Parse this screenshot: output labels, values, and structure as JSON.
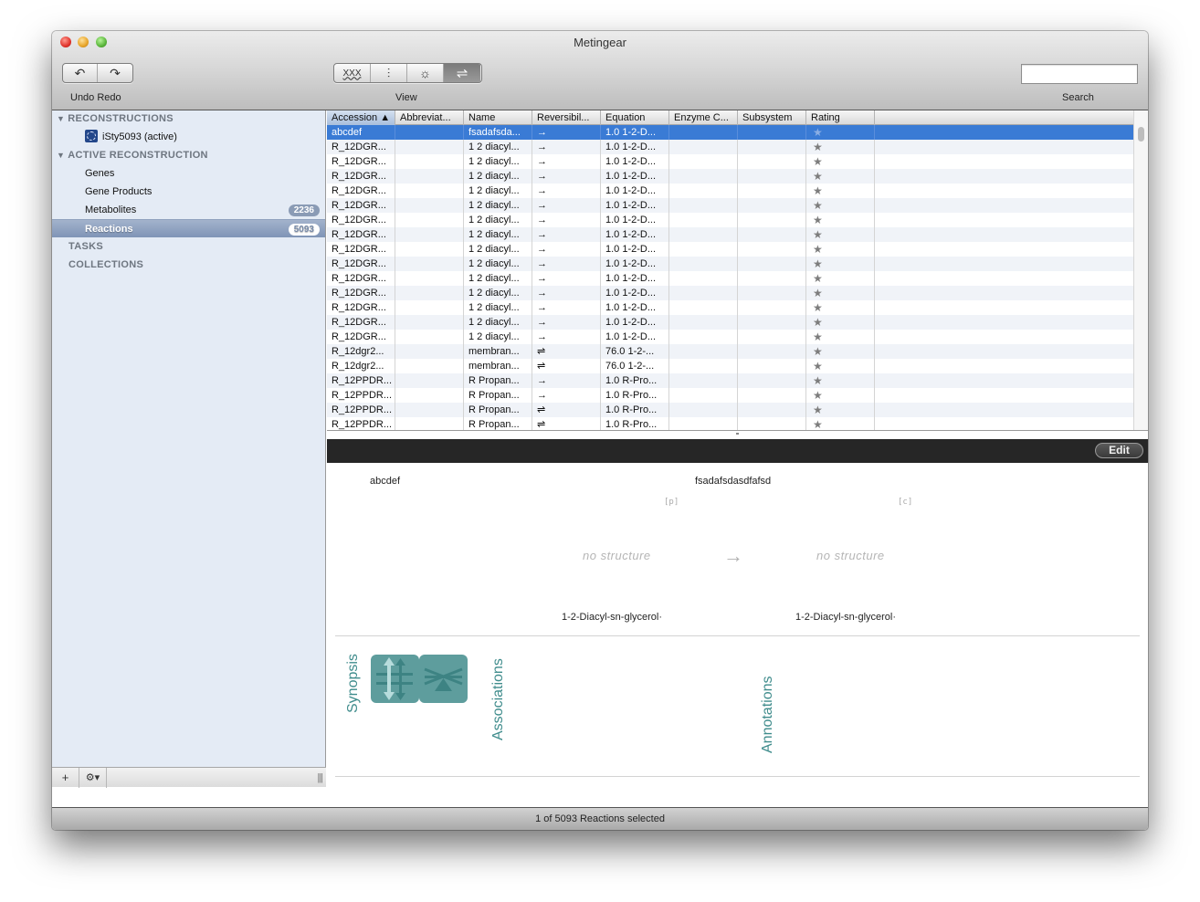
{
  "window": {
    "title": "Metingear"
  },
  "toolbar": {
    "undo_redo_label": "Undo Redo",
    "view_label": "View",
    "search_label": "Search",
    "search_value": "",
    "undo_icon": "↶",
    "redo_icon": "↷",
    "view_buttons": [
      {
        "name": "genes-view",
        "glyph": "ΧΧΧ",
        "active": false
      },
      {
        "name": "gene-products-view",
        "glyph": "⫶",
        "active": false
      },
      {
        "name": "metabolites-view",
        "glyph": "☼",
        "active": false
      },
      {
        "name": "reactions-view",
        "glyph": "⇌",
        "active": true
      }
    ]
  },
  "sidebar": {
    "groups": {
      "reconstructions": "RECONSTRUCTIONS",
      "active_reconstruction": "ACTIVE RECONSTRUCTION",
      "tasks": "TASKS",
      "collections": "COLLECTIONS"
    },
    "reconstruction_item": "iSty5093 (active)",
    "items": [
      {
        "label": "Genes",
        "badge": null
      },
      {
        "label": "Gene Products",
        "badge": null
      },
      {
        "label": "Metabolites",
        "badge": "2236"
      },
      {
        "label": "Reactions",
        "badge": "5093",
        "selected": true
      }
    ],
    "footer": {
      "add": "+",
      "gear": "⚙▾",
      "grip": "|||"
    }
  },
  "table": {
    "columns": [
      "Accession ▲",
      "Abbreviat...",
      "Name",
      "Reversibil...",
      "Equation",
      "Enzyme C...",
      "Subsystem",
      "Rating"
    ],
    "rows": [
      {
        "accession": "abcdef",
        "abbreviation": "",
        "name": "fsadafsda...",
        "reversibility": "→",
        "equation": "1.0 1-2-D...",
        "enzyme": "",
        "subsystem": "",
        "rating": "★",
        "selected": true
      },
      {
        "accession": "R_12DGR...",
        "abbreviation": "",
        "name": "1 2 diacyl...",
        "reversibility": "→",
        "equation": "1.0 1-2-D...",
        "enzyme": "",
        "subsystem": "",
        "rating": "★"
      },
      {
        "accession": "R_12DGR...",
        "abbreviation": "",
        "name": "1 2 diacyl...",
        "reversibility": "→",
        "equation": "1.0 1-2-D...",
        "enzyme": "",
        "subsystem": "",
        "rating": "★"
      },
      {
        "accession": "R_12DGR...",
        "abbreviation": "",
        "name": "1 2 diacyl...",
        "reversibility": "→",
        "equation": "1.0 1-2-D...",
        "enzyme": "",
        "subsystem": "",
        "rating": "★"
      },
      {
        "accession": "R_12DGR...",
        "abbreviation": "",
        "name": "1 2 diacyl...",
        "reversibility": "→",
        "equation": "1.0 1-2-D...",
        "enzyme": "",
        "subsystem": "",
        "rating": "★"
      },
      {
        "accession": "R_12DGR...",
        "abbreviation": "",
        "name": "1 2 diacyl...",
        "reversibility": "→",
        "equation": "1.0 1-2-D...",
        "enzyme": "",
        "subsystem": "",
        "rating": "★"
      },
      {
        "accession": "R_12DGR...",
        "abbreviation": "",
        "name": "1 2 diacyl...",
        "reversibility": "→",
        "equation": "1.0 1-2-D...",
        "enzyme": "",
        "subsystem": "",
        "rating": "★"
      },
      {
        "accession": "R_12DGR...",
        "abbreviation": "",
        "name": "1 2 diacyl...",
        "reversibility": "→",
        "equation": "1.0 1-2-D...",
        "enzyme": "",
        "subsystem": "",
        "rating": "★"
      },
      {
        "accession": "R_12DGR...",
        "abbreviation": "",
        "name": "1 2 diacyl...",
        "reversibility": "→",
        "equation": "1.0 1-2-D...",
        "enzyme": "",
        "subsystem": "",
        "rating": "★"
      },
      {
        "accession": "R_12DGR...",
        "abbreviation": "",
        "name": "1 2 diacyl...",
        "reversibility": "→",
        "equation": "1.0 1-2-D...",
        "enzyme": "",
        "subsystem": "",
        "rating": "★"
      },
      {
        "accession": "R_12DGR...",
        "abbreviation": "",
        "name": "1 2 diacyl...",
        "reversibility": "→",
        "equation": "1.0 1-2-D...",
        "enzyme": "",
        "subsystem": "",
        "rating": "★"
      },
      {
        "accession": "R_12DGR...",
        "abbreviation": "",
        "name": "1 2 diacyl...",
        "reversibility": "→",
        "equation": "1.0 1-2-D...",
        "enzyme": "",
        "subsystem": "",
        "rating": "★"
      },
      {
        "accession": "R_12DGR...",
        "abbreviation": "",
        "name": "1 2 diacyl...",
        "reversibility": "→",
        "equation": "1.0 1-2-D...",
        "enzyme": "",
        "subsystem": "",
        "rating": "★"
      },
      {
        "accession": "R_12DGR...",
        "abbreviation": "",
        "name": "1 2 diacyl...",
        "reversibility": "→",
        "equation": "1.0 1-2-D...",
        "enzyme": "",
        "subsystem": "",
        "rating": "★"
      },
      {
        "accession": "R_12DGR...",
        "abbreviation": "",
        "name": "1 2 diacyl...",
        "reversibility": "→",
        "equation": "1.0 1-2-D...",
        "enzyme": "",
        "subsystem": "",
        "rating": "★"
      },
      {
        "accession": "R_12dgr2...",
        "abbreviation": "",
        "name": "membran...",
        "reversibility": "⇌",
        "equation": "76.0 1-2-...",
        "enzyme": "",
        "subsystem": "",
        "rating": "★"
      },
      {
        "accession": "R_12dgr2...",
        "abbreviation": "",
        "name": "membran...",
        "reversibility": "⇌",
        "equation": "76.0 1-2-...",
        "enzyme": "",
        "subsystem": "",
        "rating": "★"
      },
      {
        "accession": "R_12PPDR...",
        "abbreviation": "",
        "name": "R Propan...",
        "reversibility": "→",
        "equation": "1.0 R-Pro...",
        "enzyme": "",
        "subsystem": "",
        "rating": "★"
      },
      {
        "accession": "R_12PPDR...",
        "abbreviation": "",
        "name": "R Propan...",
        "reversibility": "→",
        "equation": "1.0 R-Pro...",
        "enzyme": "",
        "subsystem": "",
        "rating": "★"
      },
      {
        "accession": "R_12PPDR...",
        "abbreviation": "",
        "name": "R Propan...",
        "reversibility": "⇌",
        "equation": "1.0 R-Pro...",
        "enzyme": "",
        "subsystem": "",
        "rating": "★"
      },
      {
        "accession": "R_12PPDR...",
        "abbreviation": "",
        "name": "R Propan...",
        "reversibility": "⇌",
        "equation": "1.0 R-Pro...",
        "enzyme": "",
        "subsystem": "",
        "rating": "★"
      }
    ]
  },
  "detail": {
    "edit_label": "Edit",
    "accession": "abcdef",
    "name": "fsadafsdasdfafsd",
    "reactant": {
      "compartment": "[p]",
      "structure": "no structure",
      "label": "1-2-Diacyl-sn-glycerol·"
    },
    "arrow": "→",
    "product": {
      "compartment": "[c]",
      "structure": "no structure",
      "label": "1-2-Diacyl-sn-glycerol·"
    },
    "tabs": {
      "synopsis": "Synopsis",
      "associations": "Associations",
      "annotations": "Annotations"
    }
  },
  "status": {
    "text": "1 of 5093 Reactions selected"
  },
  "colors": {
    "selection": "#3a7bd5",
    "accent_teal": "#5e9d9d",
    "sidebar_bg": "#e4ebf5"
  }
}
